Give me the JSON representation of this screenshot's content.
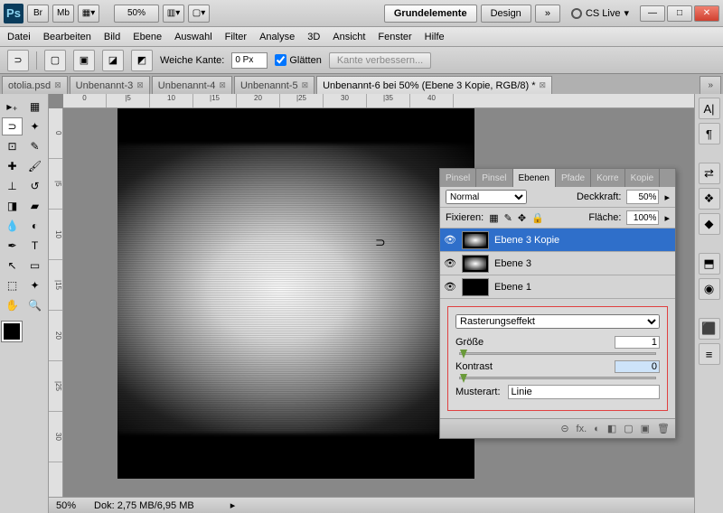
{
  "titlebar": {
    "logo": "Ps",
    "br": "Br",
    "mb": "Mb",
    "zoom": "50%",
    "ws_active": "Grundelemente",
    "ws_design": "Design",
    "more": "»",
    "cslive": "CS Live",
    "arrow": "▾"
  },
  "winbtns": {
    "min": "—",
    "max": "□",
    "close": "✕"
  },
  "menu": [
    "Datei",
    "Bearbeiten",
    "Bild",
    "Ebene",
    "Auswahl",
    "Filter",
    "Analyse",
    "3D",
    "Ansicht",
    "Fenster",
    "Hilfe"
  ],
  "options": {
    "feather_label": "Weiche Kante:",
    "feather_val": "0 Px",
    "aa_label": "Glätten",
    "refine": "Kante verbessern..."
  },
  "tabs": [
    {
      "label": "otolia.psd",
      "active": false
    },
    {
      "label": "Unbenannt-3",
      "active": false
    },
    {
      "label": "Unbenannt-4",
      "active": false
    },
    {
      "label": "Unbenannt-5",
      "active": false
    },
    {
      "label": "Unbenannt-6 bei 50% (Ebene 3 Kopie, RGB/8) *",
      "active": true
    }
  ],
  "tabs_more": "»",
  "ruler_h": [
    "0",
    "|5",
    "10",
    "|15",
    "20",
    "|25",
    "30",
    "|35",
    "40"
  ],
  "ruler_v": [
    "0",
    "|5",
    "10",
    "|15",
    "20",
    "|25",
    "30"
  ],
  "status": {
    "zoom": "50%",
    "doc": "Dok: 2,75 MB/6,95 MB"
  },
  "panel": {
    "tabs": [
      "Pinsel",
      "Pinsel",
      "Ebenen",
      "Pfade",
      "Korre",
      "Kopie"
    ],
    "active_tab": 2,
    "blend": "Normal",
    "opacity_label": "Deckkraft:",
    "opacity": "50%",
    "lock_label": "Fixieren:",
    "fill_label": "Fläche:",
    "fill": "100%",
    "layers": [
      {
        "name": "Ebene 3 Kopie",
        "sel": true,
        "thumb": "glow"
      },
      {
        "name": "Ebene 3",
        "sel": false,
        "thumb": "glow"
      },
      {
        "name": "Ebene 1",
        "sel": false,
        "thumb": "black"
      }
    ],
    "fx": {
      "select": "Rasterungseffekt",
      "size_label": "Größe",
      "size_val": "1",
      "contrast_label": "Kontrast",
      "contrast_val": "0",
      "pattern_label": "Musterart:",
      "pattern_val": "Linie"
    },
    "foot": [
      "⊝",
      "fx.",
      "◐",
      "◧",
      "▢",
      "▣",
      "🗑"
    ]
  },
  "rdock": [
    "A|",
    "¶",
    "",
    "⇄",
    "❖",
    "◆",
    "",
    "⬒",
    "◉",
    "",
    "⬛",
    "≡"
  ]
}
